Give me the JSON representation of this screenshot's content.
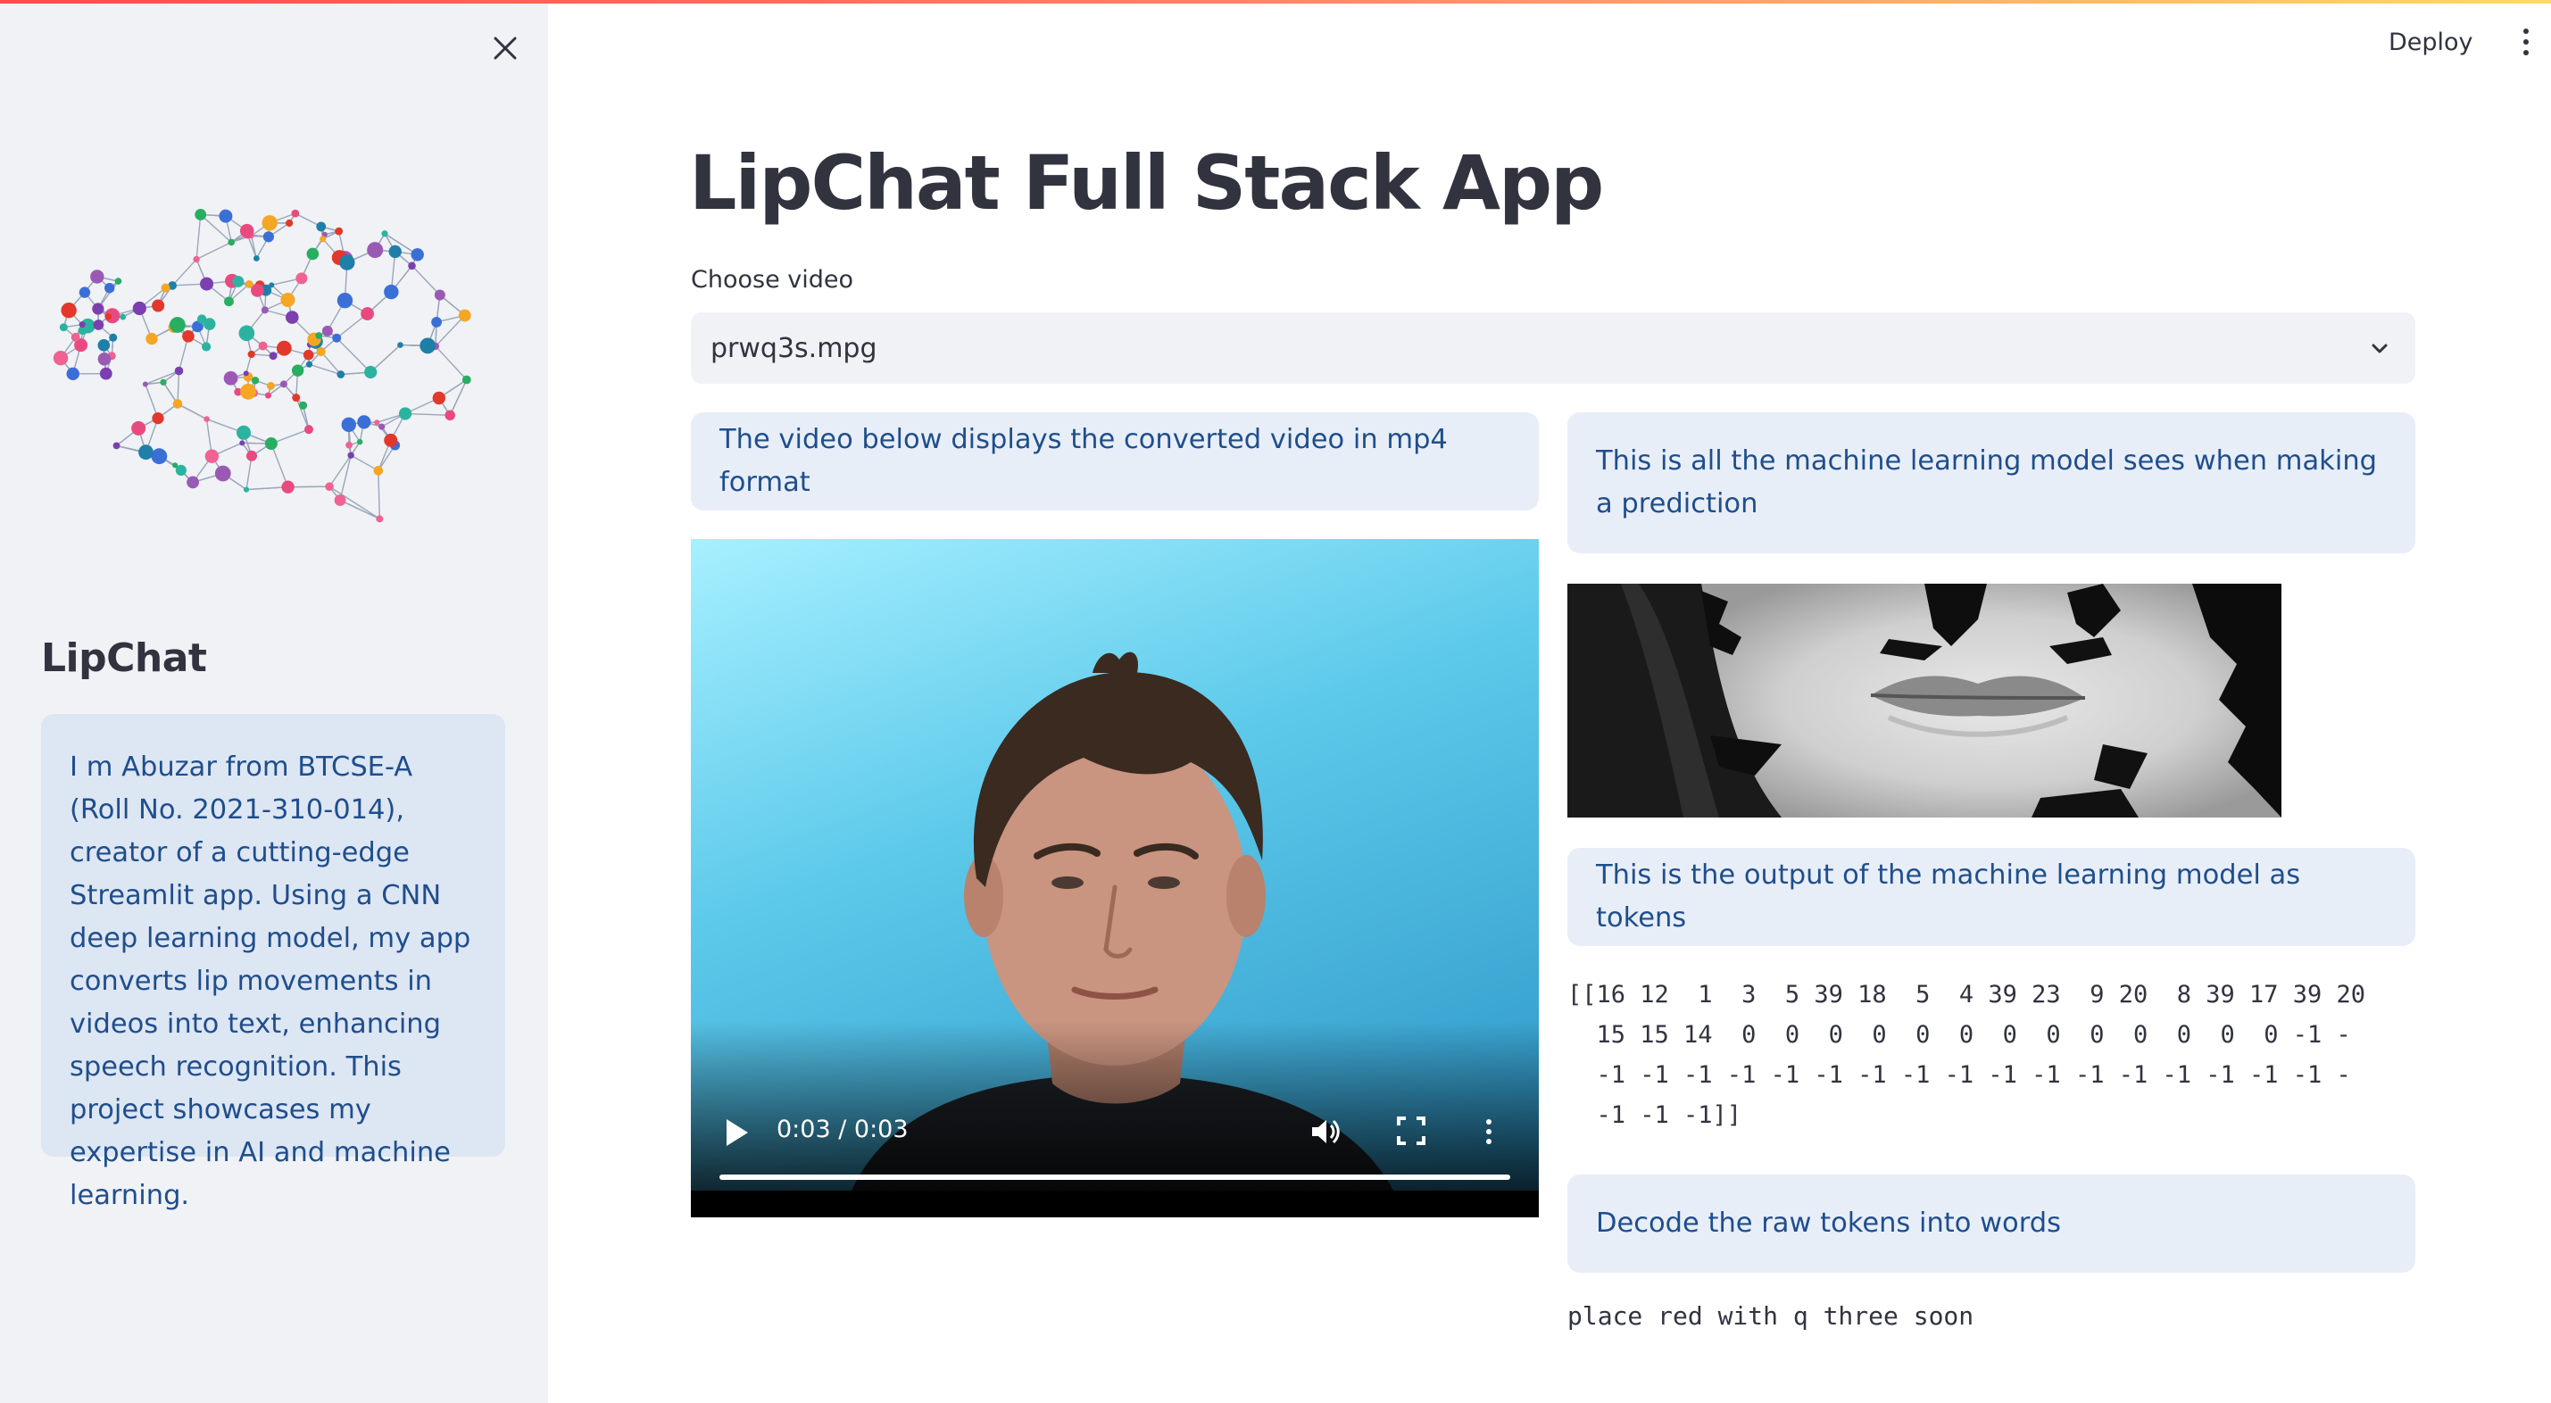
{
  "app": {
    "title": "LipChat Full Stack App",
    "deploy_label": "Deploy"
  },
  "sidebar": {
    "title": "LipChat",
    "info": "I m Abuzar from BTCSE-A (Roll No. 2021-310-014), creator of a cutting-edge Streamlit app. Using a CNN deep learning model, my app converts lip movements in videos into text, enhancing speech recognition. This project showcases my expertise in AI and machine learning.",
    "logo_icon": "brain-network-icon",
    "close_icon": "close-icon"
  },
  "select": {
    "label": "Choose video",
    "value": "prwq3s.mpg"
  },
  "columns": {
    "left_info": "The video below displays the converted video in mp4 format",
    "right_info": "This is all the machine learning model sees when making a prediction",
    "tokens_info": "This is the output of the machine learning model as tokens",
    "decode_info": "Decode the raw tokens into words"
  },
  "video": {
    "time": "0:03 / 0:03",
    "progress": 1.0
  },
  "tokens": "[[16 12  1  3  5 39 18  5  4 39 23  9 20  8 39 17 39 20\n  15 15 14  0  0  0  0  0  0  0  0  0  0  0  0  0 -1 -\n  -1 -1 -1 -1 -1 -1 -1 -1 -1 -1 -1 -1 -1 -1 -1 -1 -1 -\n  -1 -1 -1]]",
  "decoded": "place red with q three soon",
  "colors": {
    "accent_gradient": [
      "#ff4b4b",
      "#ffd966"
    ],
    "info_bg": "#e8eef8",
    "info_text": "#1f4e8c",
    "sidebar_bg": "#f0f2f6"
  }
}
